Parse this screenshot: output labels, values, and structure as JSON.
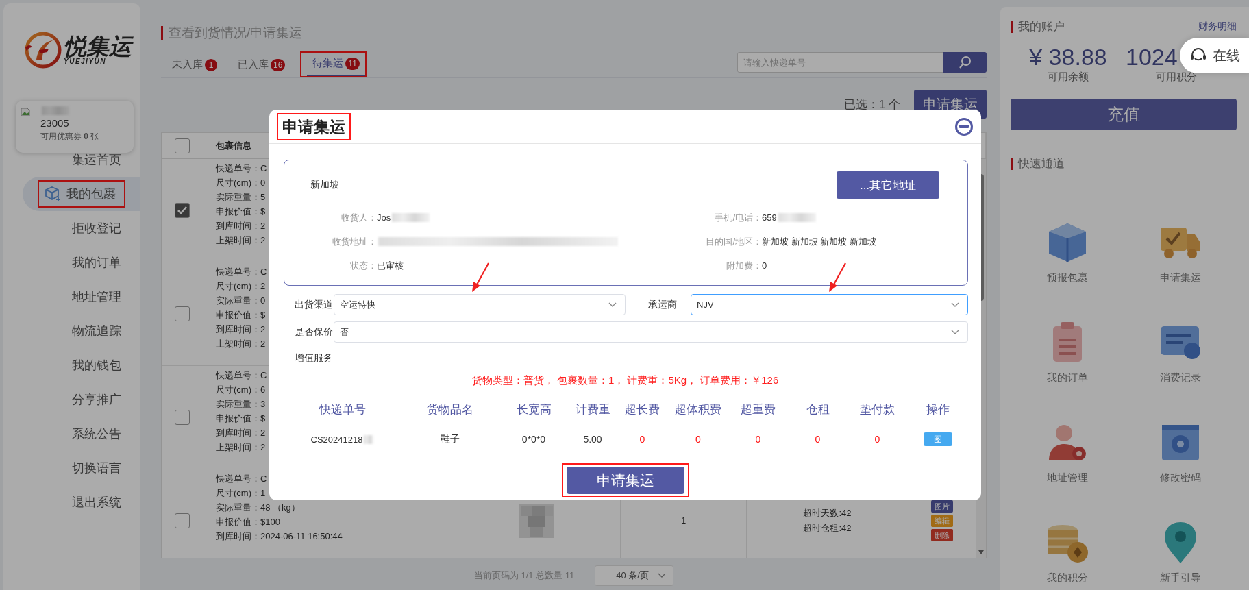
{
  "sidebar": {
    "logo": {
      "title": "悦集运",
      "subtitle": "YUEJIYUN"
    },
    "user": {
      "name_blurred": true,
      "id": "23005",
      "coupon_label": "可用优惠券",
      "coupon_count": "0",
      "coupon_unit": "张"
    },
    "items": [
      {
        "label": "集运首页",
        "selected": false,
        "highlighted": false
      },
      {
        "label": "我的包裹",
        "selected": true,
        "highlighted": true
      },
      {
        "label": "拒收登记",
        "selected": false,
        "highlighted": false
      },
      {
        "label": "我的订单",
        "selected": false,
        "highlighted": false
      },
      {
        "label": "地址管理",
        "selected": false,
        "highlighted": false
      },
      {
        "label": "物流追踪",
        "selected": false,
        "highlighted": false
      },
      {
        "label": "我的钱包",
        "selected": false,
        "highlighted": false
      },
      {
        "label": "分享推广",
        "selected": false,
        "highlighted": false
      },
      {
        "label": "系统公告",
        "selected": false,
        "highlighted": false
      },
      {
        "label": "切换语言",
        "selected": false,
        "highlighted": false
      },
      {
        "label": "退出系统",
        "selected": false,
        "highlighted": false
      }
    ]
  },
  "main": {
    "title": "查看到货情况/申请集运",
    "tabs": [
      {
        "label": "未入库",
        "count": "1",
        "selected": false,
        "highlighted": false
      },
      {
        "label": "已入库",
        "count": "16",
        "selected": false,
        "highlighted": false
      },
      {
        "label": "待集运",
        "count": "11",
        "selected": true,
        "highlighted": true
      }
    ],
    "search": {
      "placeholder": "请输入快递单号"
    },
    "selection": "已选：1 个",
    "apply_button": "申请集运",
    "table": {
      "header_checked": false,
      "header_label": "包裹信息",
      "rows": [
        {
          "checked": true,
          "lines": [
            "快递单号：C",
            "尺寸(cm)：0",
            "实际重量：5",
            "申报价值：$",
            "到库时间：2",
            "上架时间：2"
          ]
        },
        {
          "checked": false,
          "lines": [
            "快递单号：C",
            "尺寸(cm)：2",
            "实际重量：0",
            "申报价值：$",
            "到库时间：2",
            "上架时间：2"
          ]
        },
        {
          "checked": false,
          "lines": [
            "快递单号：C",
            "尺寸(cm)：6",
            "实际重量：3",
            "申报价值：$",
            "到库时间：2",
            "上架时间：2"
          ]
        },
        {
          "checked": false,
          "lines": [
            "快递单号：C",
            "尺寸(cm)：1",
            "实际重量：48 （kg）",
            "申报价值：$100",
            "到库时间：2024-06-11 16:50:44"
          ],
          "image": {
            "kind": "picture"
          },
          "count": "1",
          "overdue": [
            "超时天数:42",
            "超时仓租:42"
          ],
          "actions": [
            {
              "label": "图片",
              "kind": "view"
            },
            {
              "label": "编辑",
              "kind": "edit"
            },
            {
              "label": "删除",
              "kind": "delete"
            }
          ]
        }
      ]
    },
    "pagination": {
      "summary": "当前页码为 1/1 总数量 11",
      "page_size": "40 条/页"
    }
  },
  "account": {
    "title": "我的账户",
    "link": "财务明细",
    "balances": [
      {
        "value": "¥ 38.88",
        "label": "可用余额"
      },
      {
        "value": "1024",
        "label": "可用积分"
      }
    ],
    "recharge_button": "充值"
  },
  "service": {
    "label": "在线"
  },
  "quick": {
    "title": "快速通道",
    "items": [
      {
        "kind": "box",
        "label": "预报包裹"
      },
      {
        "kind": "truck",
        "label": "申请集运"
      },
      {
        "kind": "clipboard",
        "label": "我的订单"
      },
      {
        "kind": "bill",
        "label": "消费记录"
      },
      {
        "kind": "person",
        "label": "地址管理"
      },
      {
        "kind": "gear",
        "label": "修改密码"
      },
      {
        "kind": "coins",
        "label": "我的积分"
      },
      {
        "kind": "pin",
        "label": "新手引导"
      }
    ]
  },
  "modal": {
    "title": "申请集运",
    "title_highlighted": true,
    "address": {
      "region": "新加坡",
      "other_button": "...其它地址",
      "left_fields": [
        {
          "label": "收货人：",
          "value": "Jos",
          "blurred": true
        },
        {
          "label": "收货地址：",
          "blurred": true
        },
        {
          "label": "状态：",
          "value": "已审核",
          "blurred": false
        }
      ],
      "right_fields": [
        {
          "label": "手机/电话：",
          "value": "659",
          "blurred": true
        },
        {
          "label": "目的国/地区：",
          "value": "新加坡 新加坡 新加坡 新加坡",
          "blurred": false
        },
        {
          "label": "附加费：",
          "value": "0",
          "blurred": false
        }
      ]
    },
    "selects": [
      {
        "label": "出货渠道",
        "value": "空运特快",
        "focused": false,
        "pointer_arrow": true
      },
      {
        "label": "承运商",
        "value": "NJV",
        "focused": true,
        "pointer_arrow": true
      },
      {
        "label": "是否保价",
        "value": "否",
        "focused": false,
        "pointer_arrow": false
      }
    ],
    "services_label": "增值服务",
    "summary": "货物类型：普货， 包裹数量：1， 计费重：5Kg， 订单费用：￥126",
    "table": {
      "columns": [
        "快递单号",
        "货物品名",
        "长宽高",
        "计费重",
        "超长费",
        "超体积费",
        "超重费",
        "仓租",
        "垫付款",
        "操作"
      ],
      "rows": [
        {
          "cells": [
            {
              "kind": "tracking",
              "text": "CS20241218",
              "blurred": true
            },
            {
              "kind": "text",
              "text": "鞋子"
            },
            {
              "kind": "text",
              "text": "0*0*0"
            },
            {
              "kind": "text",
              "text": "5.00"
            },
            {
              "kind": "fee",
              "text": "0"
            },
            {
              "kind": "fee",
              "text": "0"
            },
            {
              "kind": "fee",
              "text": "0"
            },
            {
              "kind": "fee",
              "text": "0"
            },
            {
              "kind": "fee",
              "text": "0"
            },
            {
              "kind": "button",
              "text": "图"
            }
          ]
        }
      ]
    },
    "submit": {
      "label": "申请集运",
      "highlighted": true
    }
  }
}
